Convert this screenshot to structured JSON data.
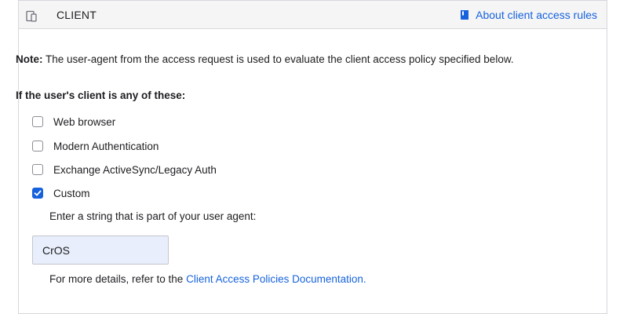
{
  "header": {
    "title": "CLIENT",
    "help_link": "About client access rules"
  },
  "note": {
    "label": "Note:",
    "text": " The user-agent from the access request is used to evaluate the client access policy specified below."
  },
  "section_label": "If the user's client is any of these:",
  "options": [
    {
      "label": "Web browser",
      "checked": false
    },
    {
      "label": "Modern Authentication",
      "checked": false
    },
    {
      "label": "Exchange ActiveSync/Legacy Auth",
      "checked": false
    },
    {
      "label": "Custom",
      "checked": true
    }
  ],
  "custom": {
    "prompt": "Enter a string that is part of your user agent:",
    "value": "CrOS"
  },
  "details": {
    "prefix": "For more details, refer to the ",
    "link": "Client Access Policies Documentation."
  },
  "colors": {
    "accent": "#1662dd",
    "header_bg": "#f5f5f6",
    "input_bg": "#e8eefb"
  }
}
